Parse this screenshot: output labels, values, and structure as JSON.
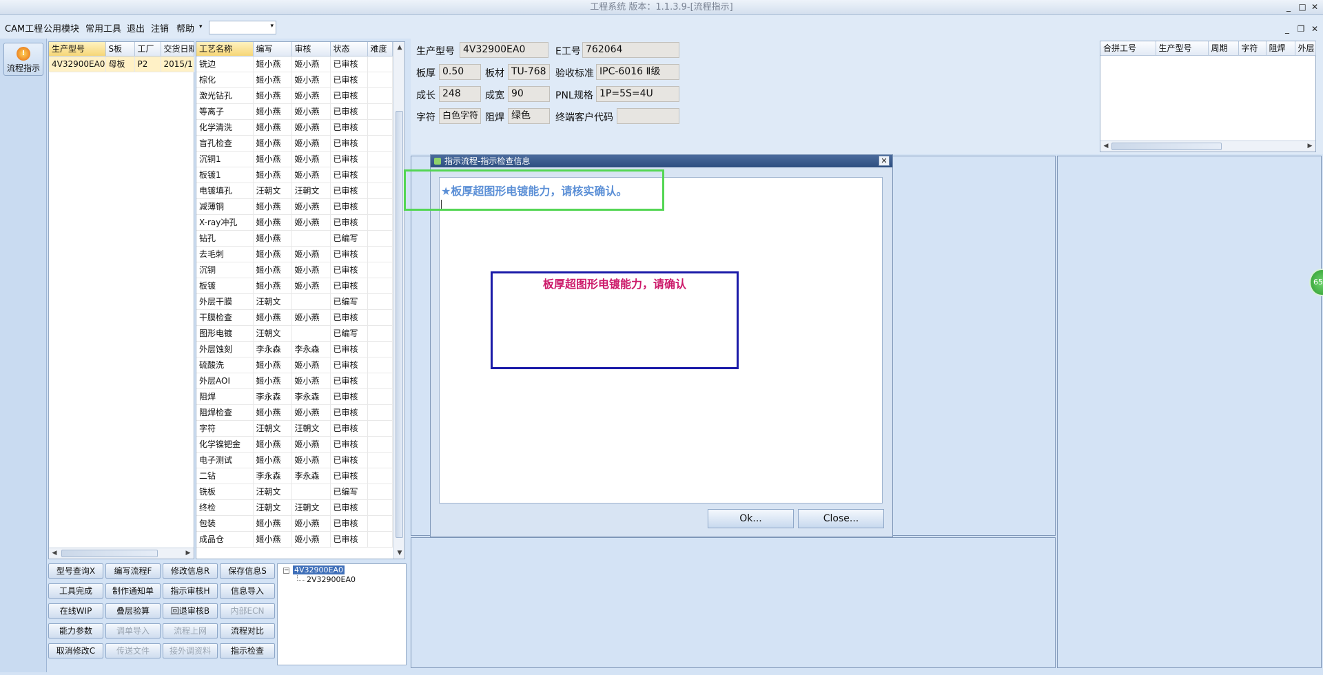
{
  "title": "工程系统 版本：1.1.3.9-[流程指示]",
  "menu": [
    "CAM工程",
    "公用模块",
    "常用工具",
    "退出",
    "注销",
    "帮助"
  ],
  "left_button": "流程指示",
  "orders": {
    "headers": [
      "生产型号",
      "S板",
      "工厂",
      "交货日期"
    ],
    "rows": [
      [
        "4V32900EA0",
        "母板",
        "P2",
        "2015/1"
      ]
    ]
  },
  "process": {
    "headers": [
      "工艺名称",
      "编写",
      "审核",
      "状态",
      "难度"
    ],
    "rows": [
      [
        "铣边",
        "姬小燕",
        "姬小燕",
        "已审核",
        ""
      ],
      [
        "棕化",
        "姬小燕",
        "姬小燕",
        "已审核",
        ""
      ],
      [
        "激光钻孔",
        "姬小燕",
        "姬小燕",
        "已审核",
        ""
      ],
      [
        "等离子",
        "姬小燕",
        "姬小燕",
        "已审核",
        ""
      ],
      [
        "化学清洗",
        "姬小燕",
        "姬小燕",
        "已审核",
        ""
      ],
      [
        "盲孔检查",
        "姬小燕",
        "姬小燕",
        "已审核",
        ""
      ],
      [
        "沉铜1",
        "姬小燕",
        "姬小燕",
        "已审核",
        ""
      ],
      [
        "板镀1",
        "姬小燕",
        "姬小燕",
        "已审核",
        ""
      ],
      [
        "电镀填孔",
        "汪朝文",
        "汪朝文",
        "已审核",
        ""
      ],
      [
        "减薄铜",
        "姬小燕",
        "姬小燕",
        "已审核",
        ""
      ],
      [
        "X-ray冲孔",
        "姬小燕",
        "姬小燕",
        "已审核",
        ""
      ],
      [
        "钻孔",
        "姬小燕",
        "",
        "已编写",
        ""
      ],
      [
        "去毛刺",
        "姬小燕",
        "姬小燕",
        "已审核",
        ""
      ],
      [
        "沉铜",
        "姬小燕",
        "姬小燕",
        "已审核",
        ""
      ],
      [
        "板镀",
        "姬小燕",
        "姬小燕",
        "已审核",
        ""
      ],
      [
        "外层干膜",
        "汪朝文",
        "",
        "已编写",
        ""
      ],
      [
        "干膜检查",
        "姬小燕",
        "姬小燕",
        "已审核",
        ""
      ],
      [
        "图形电镀",
        "汪朝文",
        "",
        "已编写",
        ""
      ],
      [
        "外层蚀刻",
        "李永森",
        "李永森",
        "已审核",
        ""
      ],
      [
        "硫酸洗",
        "姬小燕",
        "姬小燕",
        "已审核",
        ""
      ],
      [
        "外层AOI",
        "姬小燕",
        "姬小燕",
        "已审核",
        ""
      ],
      [
        "阻焊",
        "李永森",
        "李永森",
        "已审核",
        ""
      ],
      [
        "阻焊检查",
        "姬小燕",
        "姬小燕",
        "已审核",
        ""
      ],
      [
        "字符",
        "汪朝文",
        "汪朝文",
        "已审核",
        ""
      ],
      [
        "化学镍钯金",
        "姬小燕",
        "姬小燕",
        "已审核",
        ""
      ],
      [
        "电子测试",
        "姬小燕",
        "姬小燕",
        "已审核",
        ""
      ],
      [
        "二钻",
        "李永森",
        "李永森",
        "已审核",
        ""
      ],
      [
        "铣板",
        "汪朝文",
        "",
        "已编写",
        ""
      ],
      [
        "终检",
        "汪朝文",
        "汪朝文",
        "已审核",
        ""
      ],
      [
        "包装",
        "姬小燕",
        "姬小燕",
        "已审核",
        ""
      ],
      [
        "成品仓",
        "姬小燕",
        "姬小燕",
        "已审核",
        ""
      ]
    ]
  },
  "buttons": [
    {
      "label": "型号查询X",
      "disabled": false
    },
    {
      "label": "编写流程F",
      "disabled": false
    },
    {
      "label": "修改信息R",
      "disabled": false
    },
    {
      "label": "保存信息S",
      "disabled": false
    },
    {
      "label": "工具完成",
      "disabled": false
    },
    {
      "label": "制作通知单",
      "disabled": false
    },
    {
      "label": "指示审核H",
      "disabled": false
    },
    {
      "label": "信息导入",
      "disabled": false
    },
    {
      "label": "在线WIP",
      "disabled": false
    },
    {
      "label": "叠层验算",
      "disabled": false
    },
    {
      "label": "回退审核B",
      "disabled": false
    },
    {
      "label": "内部ECN",
      "disabled": true
    },
    {
      "label": "能力参数",
      "disabled": false
    },
    {
      "label": "调单导入",
      "disabled": true
    },
    {
      "label": "流程上网",
      "disabled": true
    },
    {
      "label": "流程对比",
      "disabled": false
    },
    {
      "label": "取消修改C",
      "disabled": false
    },
    {
      "label": "传送文件",
      "disabled": true
    },
    {
      "label": "接外调资料",
      "disabled": true
    },
    {
      "label": "指示检查",
      "disabled": false
    }
  ],
  "tree": {
    "root": "4V32900EA0",
    "child": "2V32900EA0"
  },
  "info": {
    "model_label": "生产型号",
    "model": "4V32900EA0",
    "eno_label": "E工号",
    "eno": "762064",
    "thick_label": "板厚",
    "thick": "0.50",
    "material_label": "板材",
    "material": "TU-768",
    "standard_label": "验收标准",
    "standard": "IPC-6016 Ⅱ级",
    "length_label": "成长",
    "length": "248",
    "width_label": "成宽",
    "width": "90",
    "pnl_label": "PNL规格",
    "pnl": "1P=5S=4U",
    "char_label": "字符",
    "char": "白色字符",
    "mask_label": "阻焊",
    "mask": "绿色",
    "customer_label": "终端客户代码",
    "customer": ""
  },
  "merge_table": {
    "headers": [
      "合拼工号",
      "生产型号",
      "周期",
      "字符",
      "阻焊",
      "外层"
    ]
  },
  "dialog": {
    "title": "指示流程-指示检查信息",
    "message": "★板厚超图形电镀能力，请核实确认。",
    "note": "板厚超图形电镀能力，请确认",
    "ok": "Ok...",
    "close": "Close..."
  },
  "float_badge": "65",
  "colors": {
    "accent": "#5b8fd6",
    "dialog_title": "#2d4e80",
    "note": "#cc1a6a",
    "green_box": "#53d653",
    "blue_box": "#1a1aa8"
  }
}
